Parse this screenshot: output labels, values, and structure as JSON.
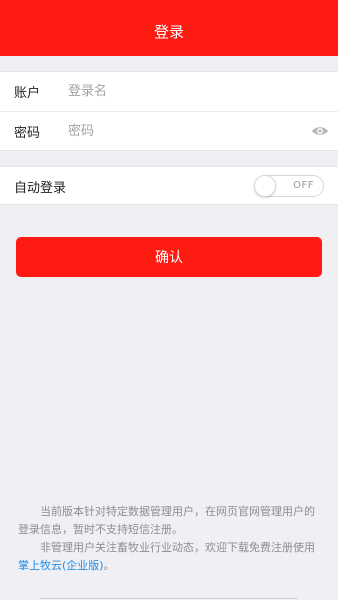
{
  "colors": {
    "brand_red": "#ff1a12",
    "background": "#efeff4",
    "link_blue": "#1f8ce6"
  },
  "header": {
    "title": "登录"
  },
  "login_form": {
    "account": {
      "label": "账户",
      "value": "",
      "placeholder": "登录名"
    },
    "password": {
      "label": "密码",
      "value": "",
      "placeholder": "密码",
      "visibility_icon": "eye-icon"
    }
  },
  "auto_login": {
    "label": "自动登录",
    "toggle_state": "OFF"
  },
  "confirm_button": {
    "label": "确认"
  },
  "footer": {
    "paragraph1": "当前版本针对特定数据管理用户，在网页官网管理用户的登录信息，暂时不支持短信注册。",
    "paragraph2_prefix": "非管理用户关注畜牧业行业动态，欢迎下载免费注册使用 ",
    "paragraph2_link": "掌上牧云(企业版)",
    "paragraph2_suffix": "。"
  }
}
